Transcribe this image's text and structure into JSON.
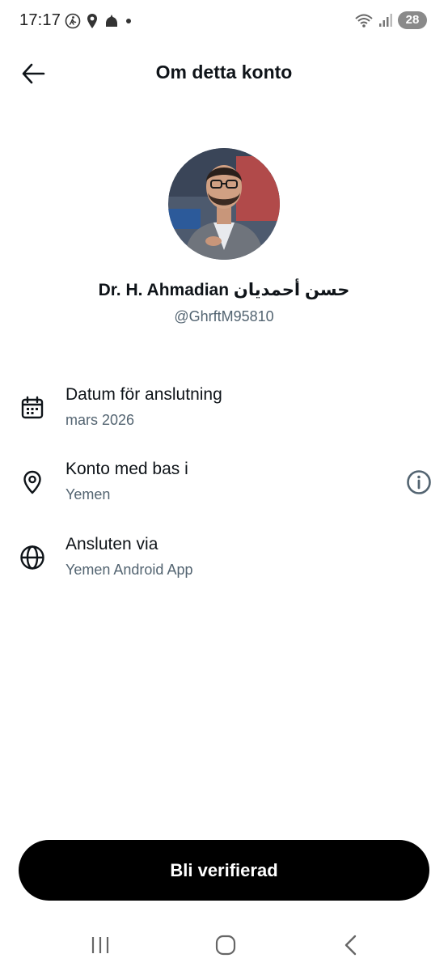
{
  "status_bar": {
    "time": "17:17",
    "battery": "28"
  },
  "header": {
    "title": "Om detta konto"
  },
  "profile": {
    "display_name": "Dr. H. Ahmadian حسن أحمديان",
    "handle": "@GhrftM95810"
  },
  "info": {
    "joined": {
      "label": "Datum för anslutning",
      "value": "mars 2026",
      "icon": "calendar-icon"
    },
    "based_in": {
      "label": "Konto med bas i",
      "value": "Yemen",
      "icon": "location-pin-icon"
    },
    "connected_via": {
      "label": "Ansluten via",
      "value": "Yemen Android App",
      "icon": "globe-icon"
    }
  },
  "actions": {
    "verify_label": "Bli verifierad"
  },
  "colors": {
    "text_primary": "#0f1419",
    "text_secondary": "#536471",
    "button_bg": "#000000",
    "button_text": "#ffffff"
  }
}
